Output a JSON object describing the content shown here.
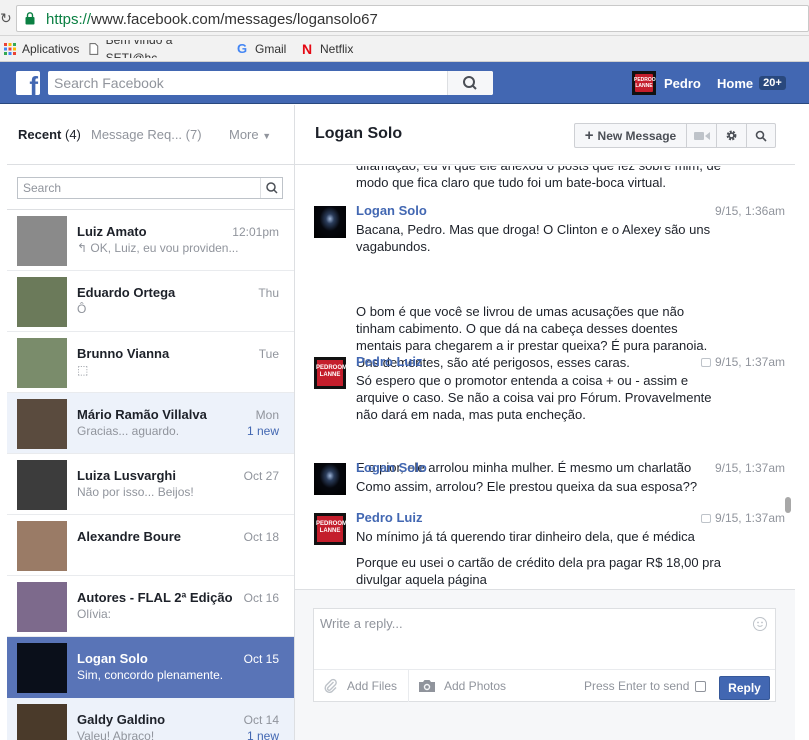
{
  "browser": {
    "url_scheme": "https://",
    "url_rest": "www.facebook.com/messages/logansolo67",
    "bookmarks": [
      "Aplicativos",
      "Bem vindo a SETI@hc",
      "Gmail",
      "Netflix"
    ]
  },
  "fb": {
    "search_placeholder": "Search Facebook",
    "user_name": "Pedro",
    "home_label": "Home",
    "home_badge": "20+"
  },
  "left": {
    "tab_recent": "Recent",
    "tab_recent_count": "(4)",
    "tab_requests": "Message Req... (7)",
    "tab_more": "More",
    "search_placeholder": "Search",
    "conversations": [
      {
        "name": "Luiz Amato",
        "date": "12:01pm",
        "snippet": "↰ OK, Luiz, eu vou providen...",
        "new": "",
        "state": "normal",
        "avatar_color": "#8a8a8a"
      },
      {
        "name": "Eduardo Ortega",
        "date": "Thu",
        "snippet": "Ô",
        "new": "",
        "state": "normal",
        "avatar_color": "#6b7a5a"
      },
      {
        "name": "Brunno Vianna",
        "date": "Tue",
        "snippet": "⬚",
        "new": "",
        "state": "normal",
        "avatar_color": "#7a8c6b"
      },
      {
        "name": "Mário Ramão Villalva",
        "date": "Mon",
        "snippet": "Gracias... aguardo.",
        "new": "1 new",
        "state": "unread",
        "avatar_color": "#5a4b3e"
      },
      {
        "name": "Luiza Lusvarghi",
        "date": "Oct 27",
        "snippet": "Não por isso... Beijos!",
        "new": "",
        "state": "normal",
        "avatar_color": "#3c3c3c"
      },
      {
        "name": "Alexandre Boure",
        "date": "Oct 18",
        "snippet": "",
        "new": "",
        "state": "normal",
        "avatar_color": "#9a7b66"
      },
      {
        "name": "Autores - FLAL 2ª Edição",
        "date": "Oct 16",
        "snippet": "Olívia:",
        "new": "",
        "state": "normal",
        "avatar_color": "#7d6a8c"
      },
      {
        "name": "Logan Solo",
        "date": "Oct 15",
        "snippet": "Sim, concordo plenamente.",
        "new": "",
        "state": "active",
        "avatar_color": "#0a0f1a"
      },
      {
        "name": "Galdy Galdino",
        "date": "Oct 14",
        "snippet": "Valeu! Abraço!",
        "new": "1 new",
        "state": "unread",
        "avatar_color": "#4a3a2a"
      }
    ]
  },
  "thread": {
    "title": "Logan Solo",
    "new_message_label": "New Message",
    "top_partial": "difamação, eu vi que ele anexou o posts que fez sobre mim, de modo que fica claro que tudo foi um bate-boca virtual.",
    "messages": [
      {
        "sender": "Logan Solo",
        "time": "9/15, 1:36am",
        "seen": false,
        "avatar": "logan",
        "paragraphs": [
          "Bacana, Pedro. Mas que droga! O Clinton e o Alexey são uns vagabundos.",
          "O bom é que você se livrou de umas acusações que não tinham cabimento. O que dá na cabeça desses doentes mentais para chegarem a ir prestar queixa? É pura paranoia. Uns dementes, são até perigosos, esses caras."
        ]
      },
      {
        "sender": "Pedro Luiz",
        "time": "9/15, 1:37am",
        "seen": true,
        "avatar": "pedro",
        "paragraphs": [
          "Só espero que o promotor entenda a coisa + ou - assim e arquive o caso. Se não a coisa vai pro Fórum. Provavelmente não dará em nada, mas puta encheção.",
          "E o pior, ele arrolou minha mulher. É mesmo um charlatão"
        ]
      },
      {
        "sender": "Logan Solo",
        "time": "9/15, 1:37am",
        "seen": false,
        "avatar": "logan",
        "paragraphs": [
          "Como assim, arrolou? Ele prestou queixa da sua esposa??"
        ]
      },
      {
        "sender": "Pedro Luiz",
        "time": "9/15, 1:37am",
        "seen": true,
        "avatar": "pedro",
        "paragraphs": [
          "No mínimo já tá querendo tirar dinheiro dela, que é médica",
          "Porque eu usei o cartão de crédito dela pra pagar R$ 18,00 pra divulgar aquela página"
        ]
      }
    ]
  },
  "reply": {
    "placeholder": "Write a reply...",
    "add_files": "Add Files",
    "add_photos": "Add Photos",
    "press_enter": "Press Enter to send",
    "reply_button": "Reply"
  },
  "colors": {
    "fb_blue": "#4267b2",
    "active_row": "#5974b7",
    "link_blue": "#4267b2"
  }
}
